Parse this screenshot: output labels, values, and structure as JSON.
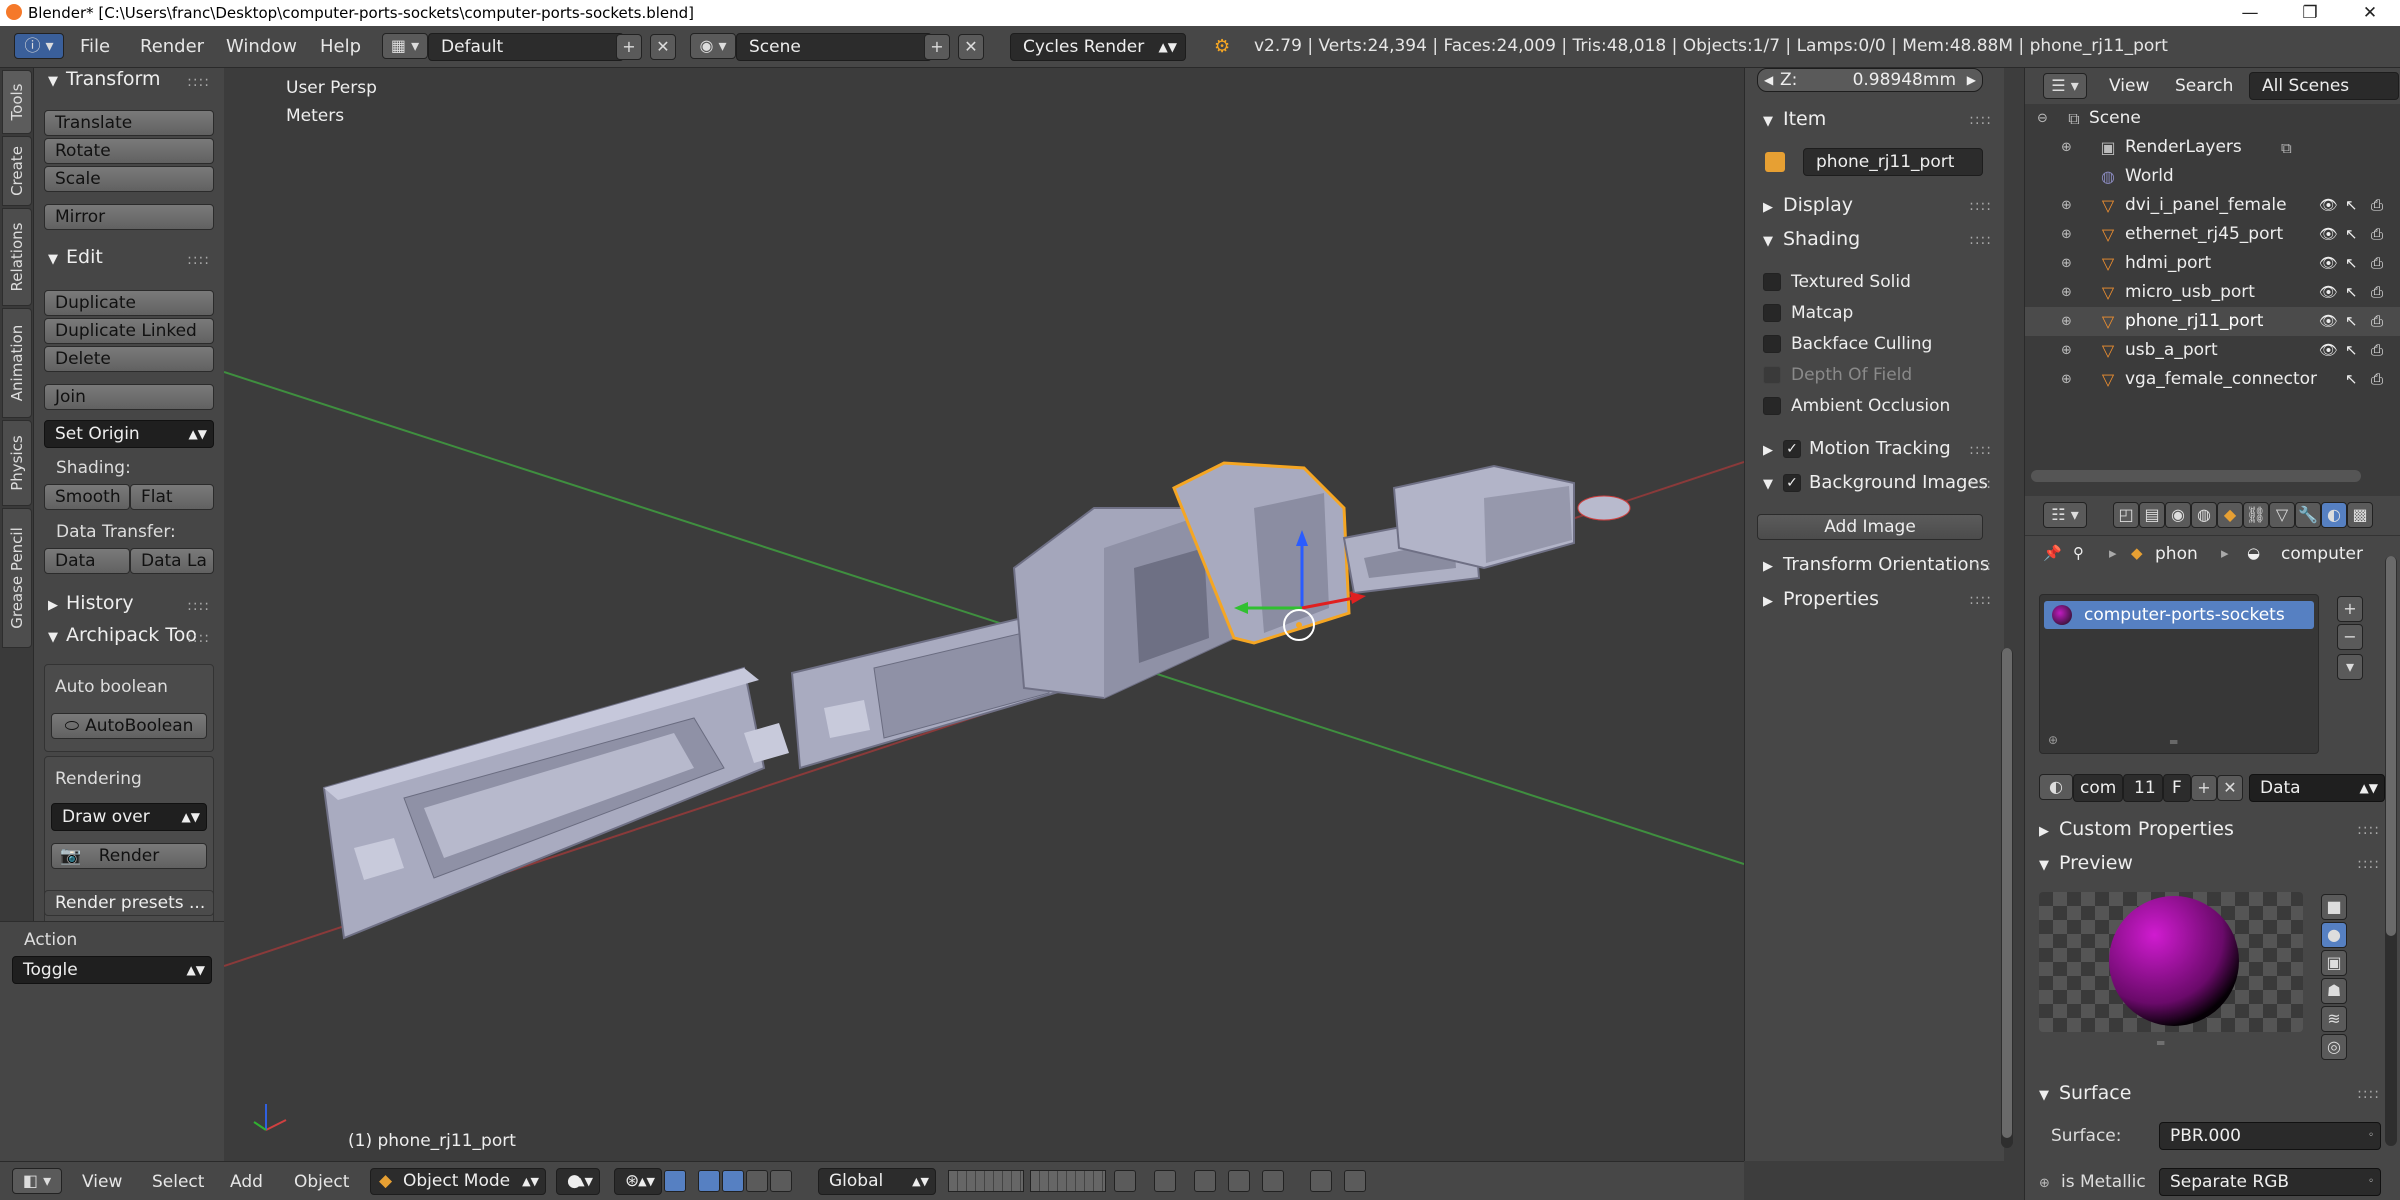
{
  "title_bar": {
    "title": "Blender* [C:\\Users\\franc\\Desktop\\computer-ports-sockets\\computer-ports-sockets.blend]",
    "minimize": "—",
    "maximize": "❐",
    "close": "✕"
  },
  "header": {
    "menus": [
      "File",
      "Render",
      "Window",
      "Help"
    ],
    "screen_layout": "Default",
    "scene": "Scene",
    "render_engine": "Cycles Render",
    "stats": "v2.79 | Verts:24,394 | Faces:24,009 | Tris:48,018 | Objects:1/7 | Lamps:0/0 | Mem:48.88M | phone_rj11_port"
  },
  "tool_tabs": [
    "Tools",
    "Create",
    "Relations",
    "Animation",
    "Physics",
    "Grease Pencil"
  ],
  "tool_shelf": {
    "transform": {
      "title": "Transform",
      "buttons": [
        "Translate",
        "Rotate",
        "Scale",
        "Mirror"
      ]
    },
    "edit": {
      "title": "Edit",
      "buttons": [
        "Duplicate",
        "Duplicate Linked",
        "Delete",
        "Join"
      ],
      "set_origin": "Set Origin",
      "shading_label": "Shading:",
      "shading_buttons": [
        "Smooth",
        "Flat"
      ],
      "data_transfer_label": "Data Transfer:",
      "data_transfer_buttons": [
        "Data",
        "Data La"
      ]
    },
    "history": {
      "title": "History"
    },
    "archipack": {
      "title": "Archipack Too",
      "auto_boolean_label": "Auto boolean",
      "auto_boolean_button": "AutoBoolean",
      "rendering_label": "Rendering",
      "draw_mode": "Draw over",
      "render_button": "Render",
      "render_presets": "Render presets ..."
    }
  },
  "action_panel": {
    "title": "Action",
    "value": "Toggle"
  },
  "viewport": {
    "view_name": "User Persp",
    "units": "Meters",
    "active_object": "(1) phone_rj11_port"
  },
  "n_panel": {
    "z_label": "Z:",
    "z_value": "0.98948mm",
    "item_title": "Item",
    "item_name": "phone_rj11_port",
    "display_title": "Display",
    "shading_title": "Shading",
    "shading_options": [
      {
        "label": "Textured Solid",
        "checked": false,
        "disabled": false
      },
      {
        "label": "Matcap",
        "checked": false,
        "disabled": false
      },
      {
        "label": "Backface Culling",
        "checked": false,
        "disabled": false
      },
      {
        "label": "Depth Of Field",
        "checked": false,
        "disabled": true
      },
      {
        "label": "Ambient Occlusion",
        "checked": false,
        "disabled": false
      }
    ],
    "motion_tracking_title": "Motion Tracking",
    "background_images_title": "Background Images",
    "add_image_button": "Add Image",
    "transform_orientations_title": "Transform Orientations",
    "properties_title": "Properties"
  },
  "outliner": {
    "header_items": [
      "View",
      "Search",
      "All Scenes"
    ],
    "rows": [
      {
        "name": "Scene",
        "level": 0,
        "icon": "scene-icon"
      },
      {
        "name": "RenderLayers",
        "level": 1,
        "icon": "render-layers-icon"
      },
      {
        "name": "World",
        "level": 1,
        "icon": "world-icon"
      },
      {
        "name": "dvi_i_panel_female",
        "level": 1,
        "icon": "mesh-icon"
      },
      {
        "name": "ethernet_rj45_port",
        "level": 1,
        "icon": "mesh-icon"
      },
      {
        "name": "hdmi_port",
        "level": 1,
        "icon": "mesh-icon"
      },
      {
        "name": "micro_usb_port",
        "level": 1,
        "icon": "mesh-icon"
      },
      {
        "name": "phone_rj11_port",
        "level": 1,
        "icon": "mesh-icon"
      },
      {
        "name": "usb_a_port",
        "level": 1,
        "icon": "mesh-icon"
      },
      {
        "name": "vga_female_connector",
        "level": 1,
        "icon": "mesh-icon"
      }
    ]
  },
  "properties": {
    "breadcrumb_object": "phon",
    "breadcrumb_material": "computer",
    "material_slot": "computer-ports-sockets",
    "material_name_short": "com",
    "user_count": "11",
    "fake_user": "F",
    "link_type": "Data",
    "custom_properties_title": "Custom Properties",
    "preview_title": "Preview",
    "surface_title": "Surface",
    "surface_label": "Surface:",
    "surface_value": "PBR.000",
    "is_metallic_label": "is Metallic",
    "is_metallic_value": "Separate RGB"
  },
  "bottom_header": {
    "menus": [
      "View",
      "Select",
      "Add",
      "Object"
    ],
    "mode": "Object Mode",
    "orientation": "Global"
  },
  "colors": {
    "accent_blue": "#5680c2",
    "selected_orange": "#f5a623",
    "panel_bg": "#474747",
    "viewport_bg": "#3c3c3c"
  }
}
